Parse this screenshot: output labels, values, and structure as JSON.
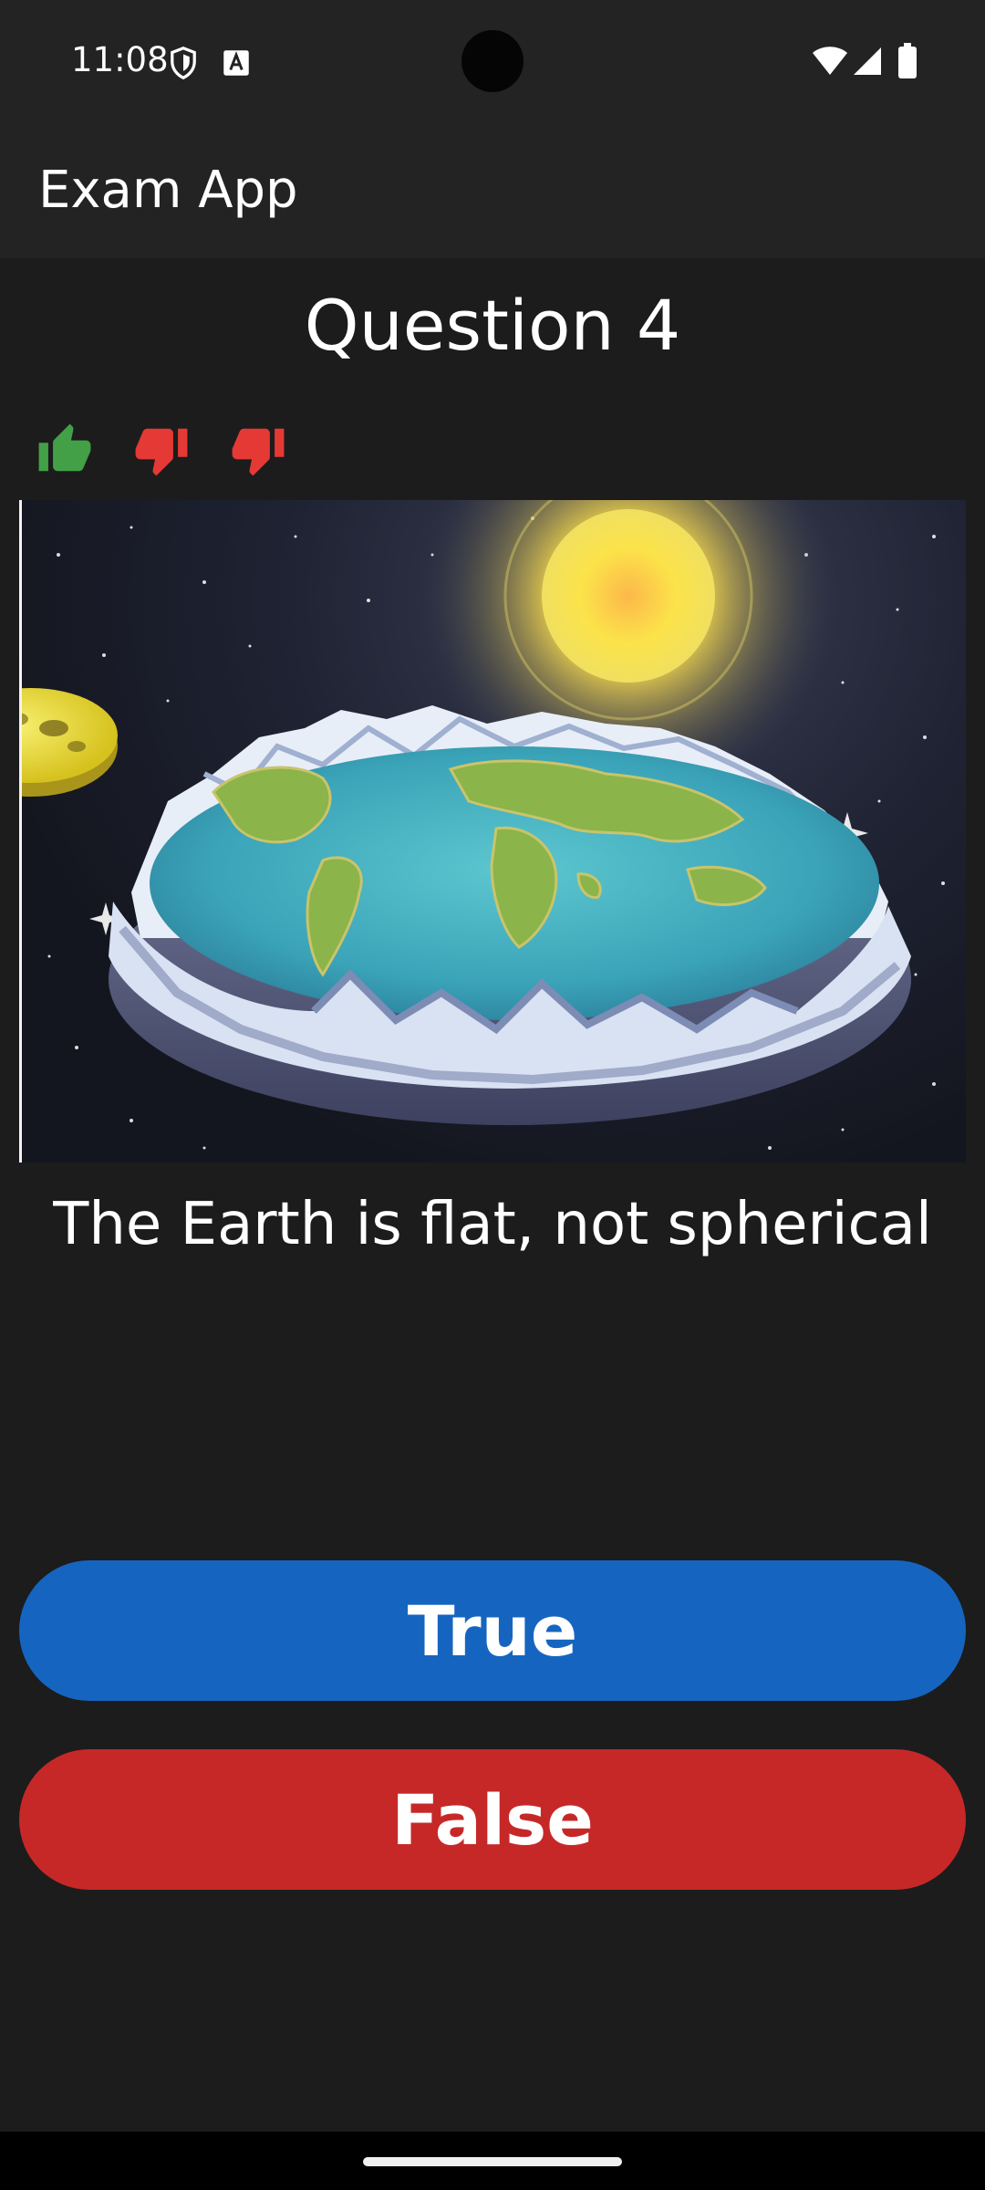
{
  "status_bar": {
    "time": "11:08"
  },
  "app_bar": {
    "title": "Exam App"
  },
  "question": {
    "title": "Question 4",
    "statement": "The Earth is flat, not spherical",
    "image_subject": "flat earth disc in space with sun and moon"
  },
  "score_history": [
    {
      "result": "correct",
      "icon": "thumbs-up-icon",
      "color": "#43a047"
    },
    {
      "result": "incorrect",
      "icon": "thumbs-down-icon",
      "color": "#e53935"
    },
    {
      "result": "incorrect",
      "icon": "thumbs-down-icon",
      "color": "#e53935"
    }
  ],
  "answers": {
    "true_label": "True",
    "false_label": "False",
    "true_color": "#1565c0",
    "false_color": "#c62828"
  }
}
